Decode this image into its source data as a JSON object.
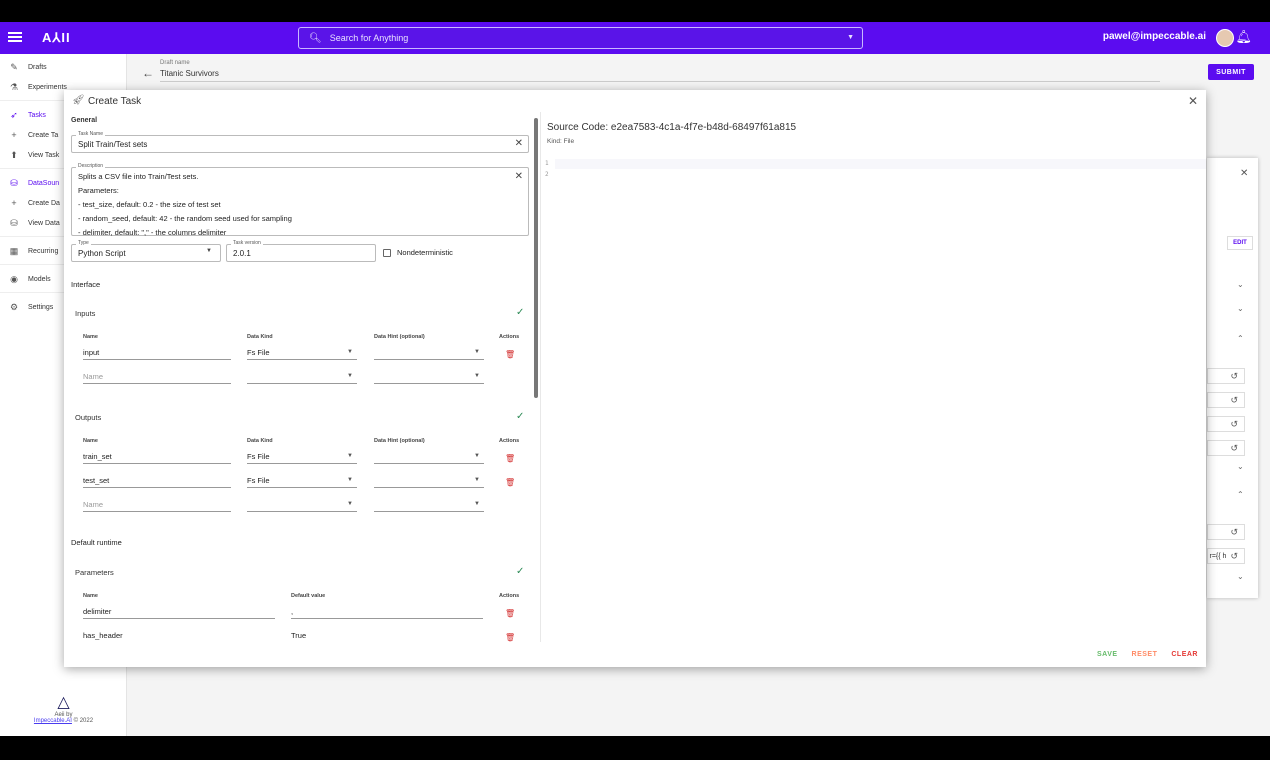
{
  "topbar": {
    "logo": "A⅄II",
    "search_placeholder": "Search for Anything",
    "user_email": "pawel@impeccable.ai"
  },
  "sidebar": {
    "items": [
      {
        "label": "Drafts",
        "icon": "drafts-icon",
        "glyph": "✎"
      },
      {
        "label": "Experiments",
        "icon": "flask-icon",
        "glyph": "⚗"
      },
      {
        "label": "Tasks",
        "icon": "rocket-icon",
        "glyph": "🚀"
      },
      {
        "label": "Create Ta",
        "icon": "plus-icon",
        "glyph": "+"
      },
      {
        "label": "View Task",
        "icon": "rocket-view-icon",
        "glyph": "⬆"
      },
      {
        "label": "DataSoun",
        "icon": "database-icon",
        "glyph": "⛁"
      },
      {
        "label": "Create Da",
        "icon": "plus-icon",
        "glyph": "+"
      },
      {
        "label": "View Data",
        "icon": "database-view-icon",
        "glyph": "⛁"
      },
      {
        "label": "Recurring",
        "icon": "calendar-icon",
        "glyph": "▦"
      },
      {
        "label": "Models",
        "icon": "model-icon",
        "glyph": "◉"
      },
      {
        "label": "Settings",
        "icon": "gear-icon",
        "glyph": "⚙"
      }
    ],
    "footer_line1": "Aeii by",
    "footer_link": "Impeccable.AI",
    "footer_year": "© 2022"
  },
  "draft": {
    "label": "Draft name",
    "name": "Titanic Survivors",
    "submit": "SUBMIT"
  },
  "background_panel": {
    "edit": "EDIT",
    "text_fragment": "r={{ h"
  },
  "modal": {
    "title": "Create Task",
    "general": {
      "section_title": "General",
      "task_name_label": "Task Name",
      "task_name": "Split Train/Test sets",
      "description_label": "Description",
      "description_lines": [
        "Splits a CSV file into Train/Test sets.",
        "Parameters:",
        "- test_size, default: 0.2 - the size of test set",
        "- random_seed, default: 42 - the random seed used for sampling",
        "- delimiter, default: \",\" - the columns delimiter"
      ],
      "type_label": "Type",
      "type_value": "Python Script",
      "version_label": "Task version",
      "version_value": "2.0.1",
      "nondeterministic_label": "Nondeterministic"
    },
    "interface": {
      "section_title": "Interface",
      "inputs_title": "Inputs",
      "outputs_title": "Outputs",
      "headers": {
        "name": "Name",
        "data_kind": "Data Kind",
        "data_hint": "Data Hint (optional)",
        "actions": "Actions"
      },
      "inputs": [
        {
          "name": "input",
          "kind": "Fs File"
        }
      ],
      "outputs": [
        {
          "name": "train_set",
          "kind": "Fs File"
        },
        {
          "name": "test_set",
          "kind": "Fs File"
        }
      ],
      "name_placeholder": "Name"
    },
    "runtime": {
      "section_title": "Default runtime",
      "parameters_title": "Parameters",
      "headers": {
        "name": "Name",
        "default_value": "Default value",
        "actions": "Actions"
      },
      "parameters": [
        {
          "name": "delimiter",
          "value": ","
        },
        {
          "name": "has_header",
          "value": "True"
        }
      ]
    },
    "source": {
      "title": "Source Code: e2ea7583-4c1a-4f7e-b48d-68497f61a815",
      "kind": "Kind: File",
      "line_numbers": [
        "1",
        "2"
      ]
    },
    "actions": {
      "save": "SAVE",
      "reset": "RESET",
      "clear": "CLEAR"
    }
  },
  "colors": {
    "brand": "#5b0cf0",
    "save": "#66bb6a",
    "reset": "#ff8a65",
    "clear": "#e53935"
  }
}
